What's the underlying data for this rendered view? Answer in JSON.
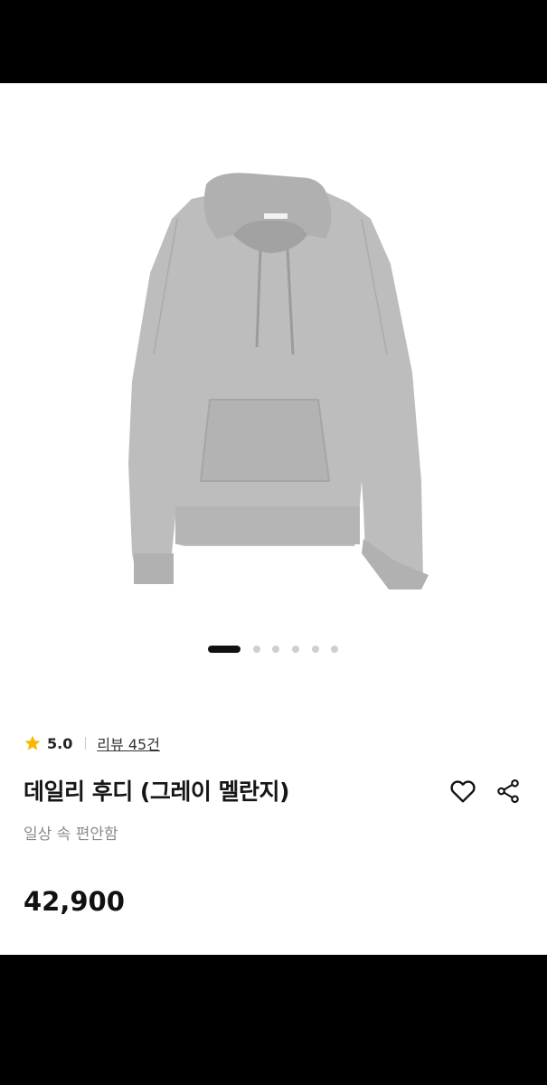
{
  "product": {
    "rating": "5.0",
    "review_link": "리뷰 45건",
    "title": "데일리 후디 (그레이 멜란지)",
    "subtitle": "일상 속 편안함",
    "price": "42,900"
  },
  "gallery": {
    "image_count": 6,
    "active_index": 0,
    "image_subject": "gray hoodie"
  },
  "icons": {
    "rating": "star-icon",
    "like": "heart-icon",
    "share": "share-icon"
  },
  "colors": {
    "star": "#f5b800",
    "hoodie": "#b9b9b9",
    "active_dot": "#111111",
    "inactive_dot": "#cfcfcf"
  }
}
